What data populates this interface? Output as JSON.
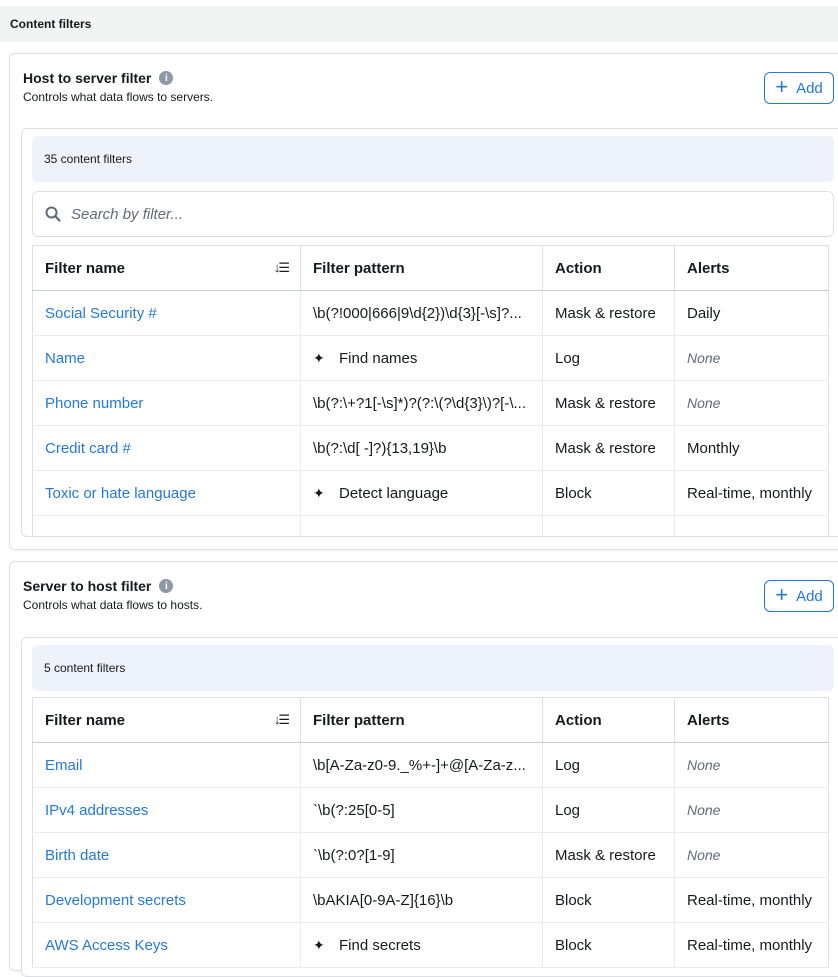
{
  "page": {
    "title": "Content filters"
  },
  "host_to_server": {
    "title": "Host to server filter",
    "description": "Controls what data flows to servers.",
    "add_label": "Add",
    "count_text": "35 content filters",
    "search_placeholder": "Search by filter...",
    "columns": [
      "Filter name",
      "Filter pattern",
      "Action",
      "Alerts"
    ],
    "rows": [
      {
        "name": "Social Security #",
        "pattern": "\\b(?!000|666|9\\d{2})\\d{3}[-\\s]?...",
        "icon": "",
        "action": "Mask & restore",
        "alerts": "Daily",
        "alerts_none": false
      },
      {
        "name": "Name",
        "pattern": "Find names",
        "icon": "magic-wand-icon",
        "action": "Log",
        "alerts": "None",
        "alerts_none": true
      },
      {
        "name": "Phone number",
        "pattern": "\\b(?:\\+?1[-\\s]*)?(?:\\(?\\d{3}\\)?[-\\...",
        "icon": "",
        "action": "Mask & restore",
        "alerts": "None",
        "alerts_none": true
      },
      {
        "name": "Credit card #",
        "pattern": "\\b(?:\\d[ -]?){13,19}\\b",
        "icon": "",
        "action": "Mask & restore",
        "alerts": "Monthly",
        "alerts_none": false
      },
      {
        "name": "Toxic or hate language",
        "pattern": "Detect language",
        "icon": "magic-wand-icon",
        "action": "Block",
        "alerts": "Real-time, monthly",
        "alerts_none": false
      }
    ]
  },
  "server_to_host": {
    "title": "Server to host filter",
    "description": "Controls what data flows to hosts.",
    "add_label": "Add",
    "count_text": "5 content filters",
    "columns": [
      "Filter name",
      "Filter pattern",
      "Action",
      "Alerts"
    ],
    "rows": [
      {
        "name": "Email",
        "pattern": "\\b[A-Za-z0-9._%+-]+@[A-Za-z...",
        "icon": "",
        "action": "Log",
        "alerts": "None",
        "alerts_none": true
      },
      {
        "name": "IPv4 addresses",
        "pattern": "`\\b(?:25[0-5]",
        "icon": "",
        "action": "Log",
        "alerts": "None",
        "alerts_none": true
      },
      {
        "name": "Birth date",
        "pattern": "`\\b(?:0?[1-9]",
        "icon": "",
        "action": "Mask & restore",
        "alerts": "None",
        "alerts_none": true
      },
      {
        "name": "Development secrets",
        "pattern": "\\bAKIA[0-9A-Z]{16}\\b",
        "icon": "",
        "action": "Block",
        "alerts": "Real-time, monthly",
        "alerts_none": false
      },
      {
        "name": "AWS Access Keys",
        "pattern": "Find secrets",
        "icon": "magic-wand-icon",
        "action": "Block",
        "alerts": "Real-time, monthly",
        "alerts_none": false
      }
    ]
  },
  "colors": {
    "link": "#2479d7",
    "count_bar": "#edf2fb",
    "header_bg": "#f2f3f3",
    "border": "#dcdfe4"
  }
}
